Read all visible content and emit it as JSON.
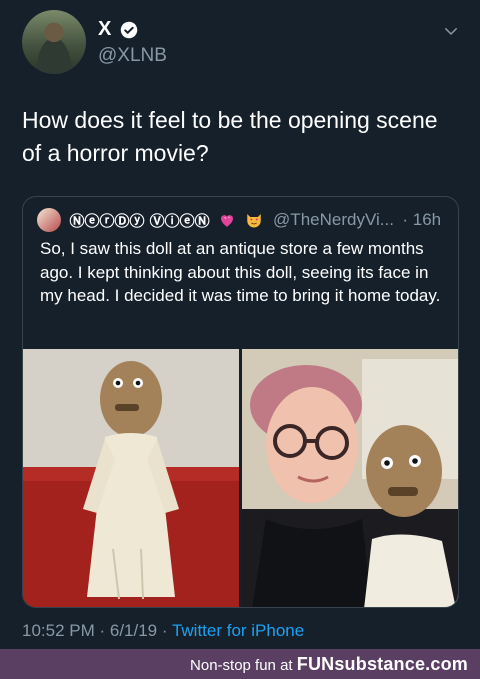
{
  "tweet": {
    "display_name": "X",
    "handle": "@XLNB",
    "text": "How does it feel to be the opening scene of a horror movie?",
    "timestamp": "10:52 PM · 6/1/19 · ",
    "source": "Twitter for iPhone",
    "verified_icon": "verified-badge-icon",
    "menu_icon": "chevron-down-icon"
  },
  "quote": {
    "display_name": "ⓃⓔⓡⒹⓨ ⓋⓘⓔⓃ",
    "handle": "@TheNerdyVi...",
    "time": "· 16h",
    "text": "So, I saw this doll at an antique store a few months ago. I kept thinking about this doll, seeing its face in my head. I decided it was time to bring it home today.",
    "emoji": [
      "heart-icon",
      "heart-eyes-cat-icon"
    ]
  },
  "banner": {
    "lead": "Non-stop fun at ",
    "brand": "FUNsubstance.com"
  },
  "colors": {
    "background": "#15202b",
    "secondary_text": "#8899a6",
    "link": "#1da1f2",
    "banner": "#5a3f63"
  }
}
